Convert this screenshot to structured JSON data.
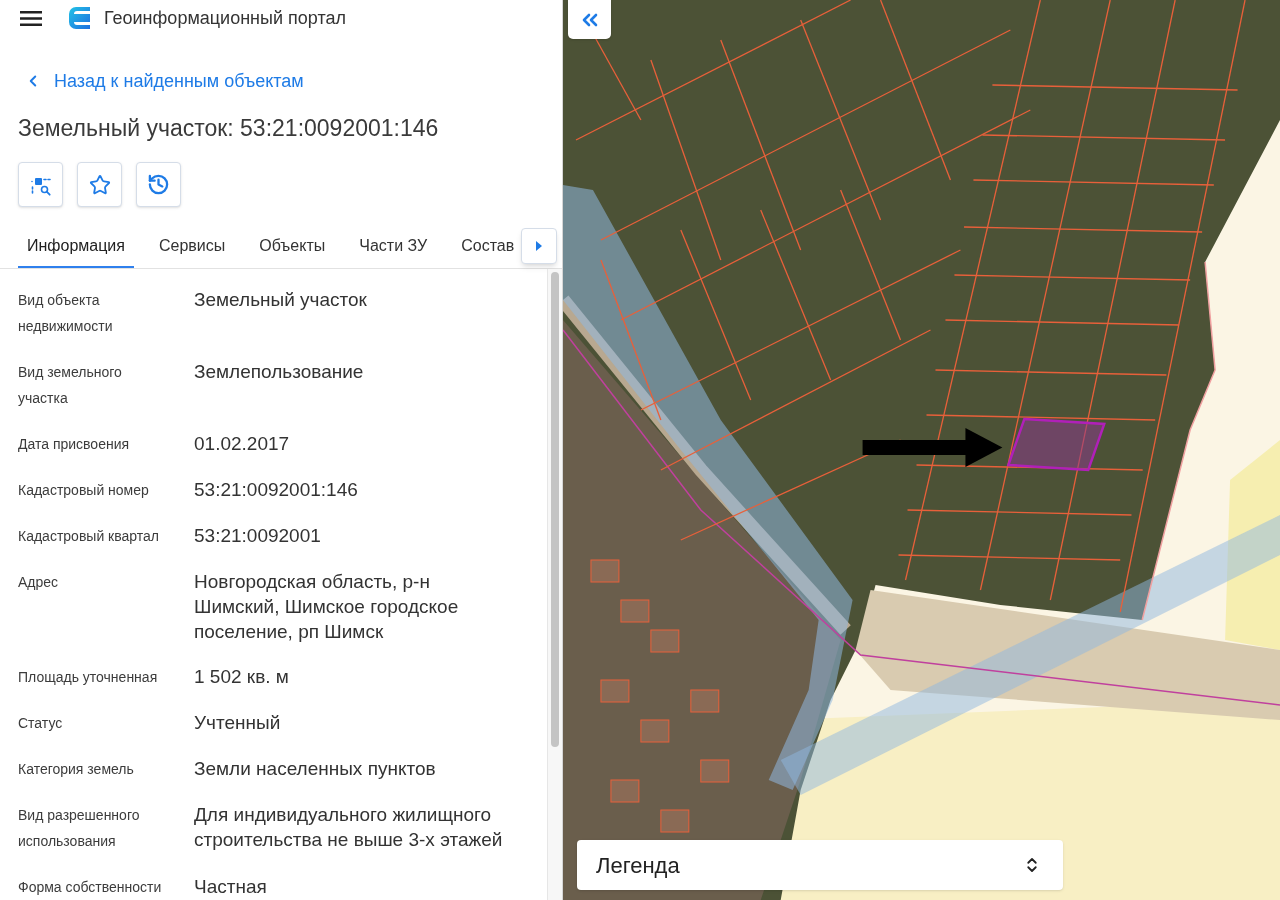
{
  "header": {
    "title": "Геоинформационный портал"
  },
  "back_link": "Назад к найденным объектам",
  "object_title": "Земельный участок: 53:21:0092001:146",
  "tabs": [
    {
      "label": "Информация",
      "selected": true
    },
    {
      "label": "Сервисы",
      "selected": false
    },
    {
      "label": "Объекты",
      "selected": false
    },
    {
      "label": "Части ЗУ",
      "selected": false
    },
    {
      "label": "Состав",
      "selected": false
    }
  ],
  "properties": [
    {
      "label": "Вид объекта недвижимости",
      "value": "Земельный участок"
    },
    {
      "label": "Вид земельного участка",
      "value": "Землепользование"
    },
    {
      "label": "Дата присвоения",
      "value": "01.02.2017"
    },
    {
      "label": "Кадастровый номер",
      "value": "53:21:0092001:146"
    },
    {
      "label": "Кадастровый квартал",
      "value": "53:21:0092001"
    },
    {
      "label": "Адрес",
      "value": "Новгородская область, р-н Шимский, Шимское городское поселение, рп Шимск"
    },
    {
      "label": "Площадь уточненная",
      "value": "1 502 кв. м"
    },
    {
      "label": "Статус",
      "value": "Учтенный"
    },
    {
      "label": "Категория земель",
      "value": "Земли населенных пунктов"
    },
    {
      "label": "Вид разрешенного использования",
      "value": "Для индивидуального жилищного строительства не выше 3-х этажей"
    },
    {
      "label": "Форма собственности",
      "value": "Частная"
    }
  ],
  "legend": {
    "title": "Легенда"
  }
}
